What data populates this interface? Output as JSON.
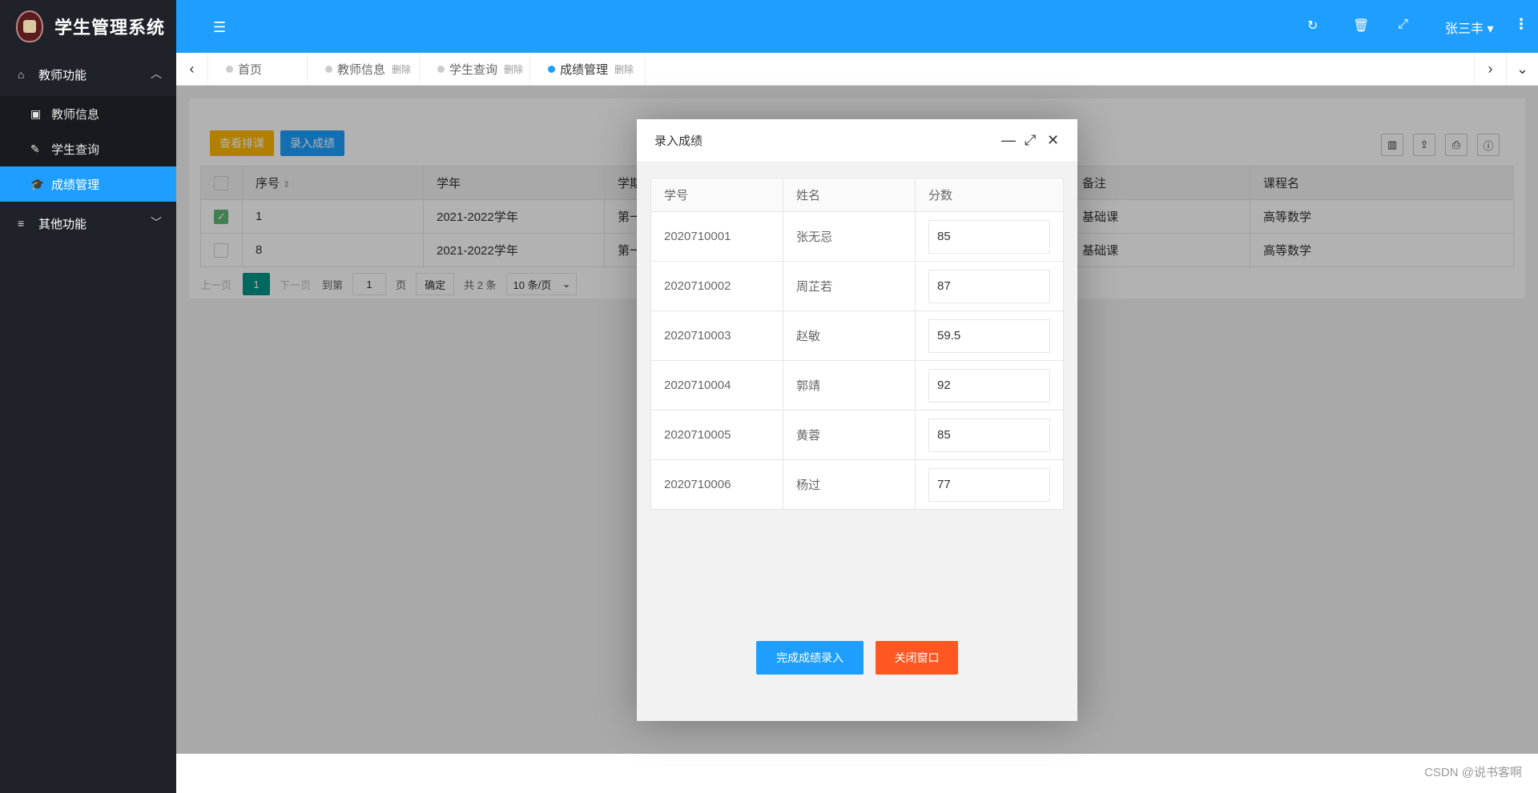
{
  "app": {
    "title": "学生管理系统"
  },
  "header": {
    "user": "张三丰"
  },
  "sidebar": {
    "groups": [
      {
        "label": "教师功能",
        "items": [
          {
            "label": "教师信息"
          },
          {
            "label": "学生查询"
          },
          {
            "label": "成绩管理"
          }
        ]
      },
      {
        "label": "其他功能"
      }
    ]
  },
  "tabs": [
    {
      "label": "首页",
      "del": ""
    },
    {
      "label": "教师信息",
      "del": "删除"
    },
    {
      "label": "学生查询",
      "del": "删除"
    },
    {
      "label": "成绩管理",
      "del": "删除"
    }
  ],
  "toolbar": {
    "view_schedule": "查看排课",
    "enter_scores": "录入成绩"
  },
  "grid": {
    "headers": [
      "序号",
      "学年",
      "学期",
      "备注",
      "课程名"
    ],
    "rows": [
      {
        "no": "1",
        "year": "2021-2022学年",
        "term": "第一",
        "note": "基础课",
        "course": "高等数学"
      },
      {
        "no": "8",
        "year": "2021-2022学年",
        "term": "第一",
        "note": "基础课",
        "course": "高等数学"
      }
    ]
  },
  "pager": {
    "prev": "上一页",
    "current": "1",
    "next": "下一页",
    "goto": "到第",
    "page_value": "1",
    "page_unit": "页",
    "confirm": "确定",
    "total": "共 2 条",
    "per_page": "10 条/页"
  },
  "modal": {
    "title": "录入成绩",
    "headers": [
      "学号",
      "姓名",
      "分数"
    ],
    "rows": [
      {
        "id": "2020710001",
        "name": "张无忌",
        "score": "85"
      },
      {
        "id": "2020710002",
        "name": "周芷若",
        "score": "87"
      },
      {
        "id": "2020710003",
        "name": "赵敏",
        "score": "59.5"
      },
      {
        "id": "2020710004",
        "name": "郭靖",
        "score": "92"
      },
      {
        "id": "2020710005",
        "name": "黄蓉",
        "score": "85"
      },
      {
        "id": "2020710006",
        "name": "杨过",
        "score": "77"
      }
    ],
    "submit": "完成成绩录入",
    "close": "关闭窗口"
  },
  "footer": {
    "watermark": "CSDN @说书客啊"
  },
  "colors": {
    "primary": "#1e9fff",
    "sidebar": "#20222a",
    "warn": "#ffb800",
    "danger": "#ff5722",
    "pager_active": "#009688"
  }
}
